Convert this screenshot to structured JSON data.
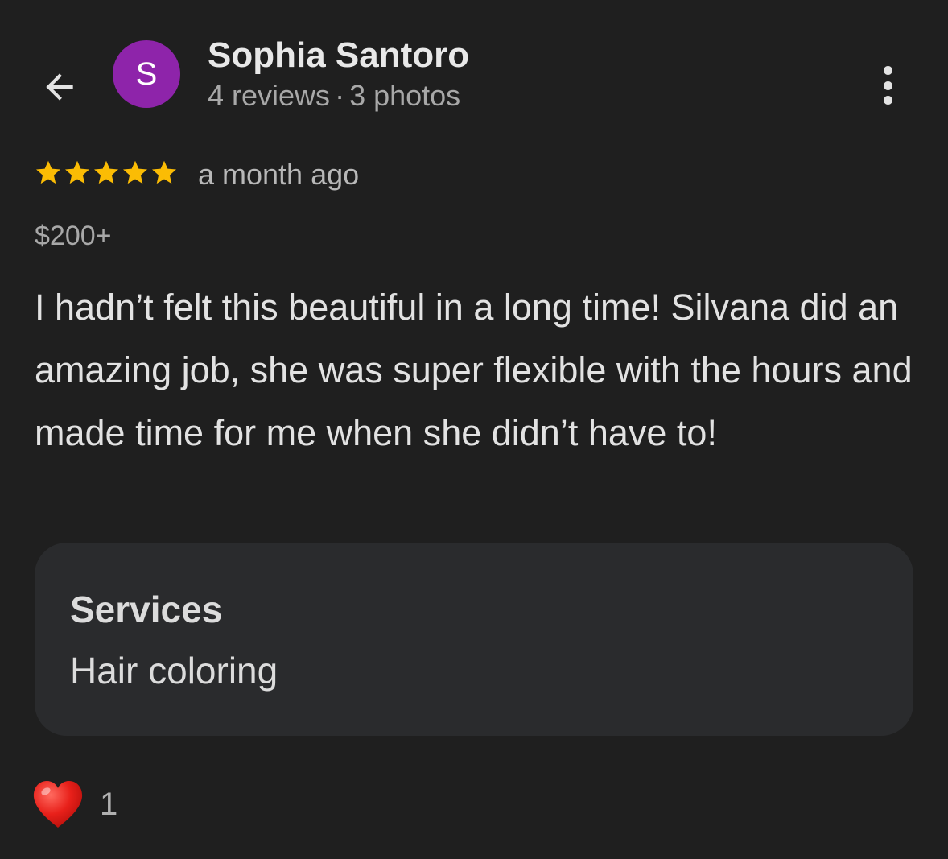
{
  "header": {
    "back_icon": "arrow-back-icon",
    "avatar_letter": "S",
    "avatar_color": "#8e24aa",
    "user_name": "Sophia Santoro",
    "reviews": "4 reviews",
    "separator": "·",
    "photos": "3 photos",
    "more_icon": "more-vert-icon"
  },
  "review": {
    "rating": 5,
    "rating_max": 5,
    "star_color": "#fbbc04",
    "time_ago": "a month ago",
    "price": "$200+",
    "text": "I hadn’t felt this beautiful in a long time! Silvana did an amazing job, she was super flexible with the hours and made time for me when she didn’t have to!"
  },
  "services": {
    "label": "Services",
    "value": "Hair coloring"
  },
  "reaction": {
    "icon": "heart-icon",
    "count": "1"
  }
}
